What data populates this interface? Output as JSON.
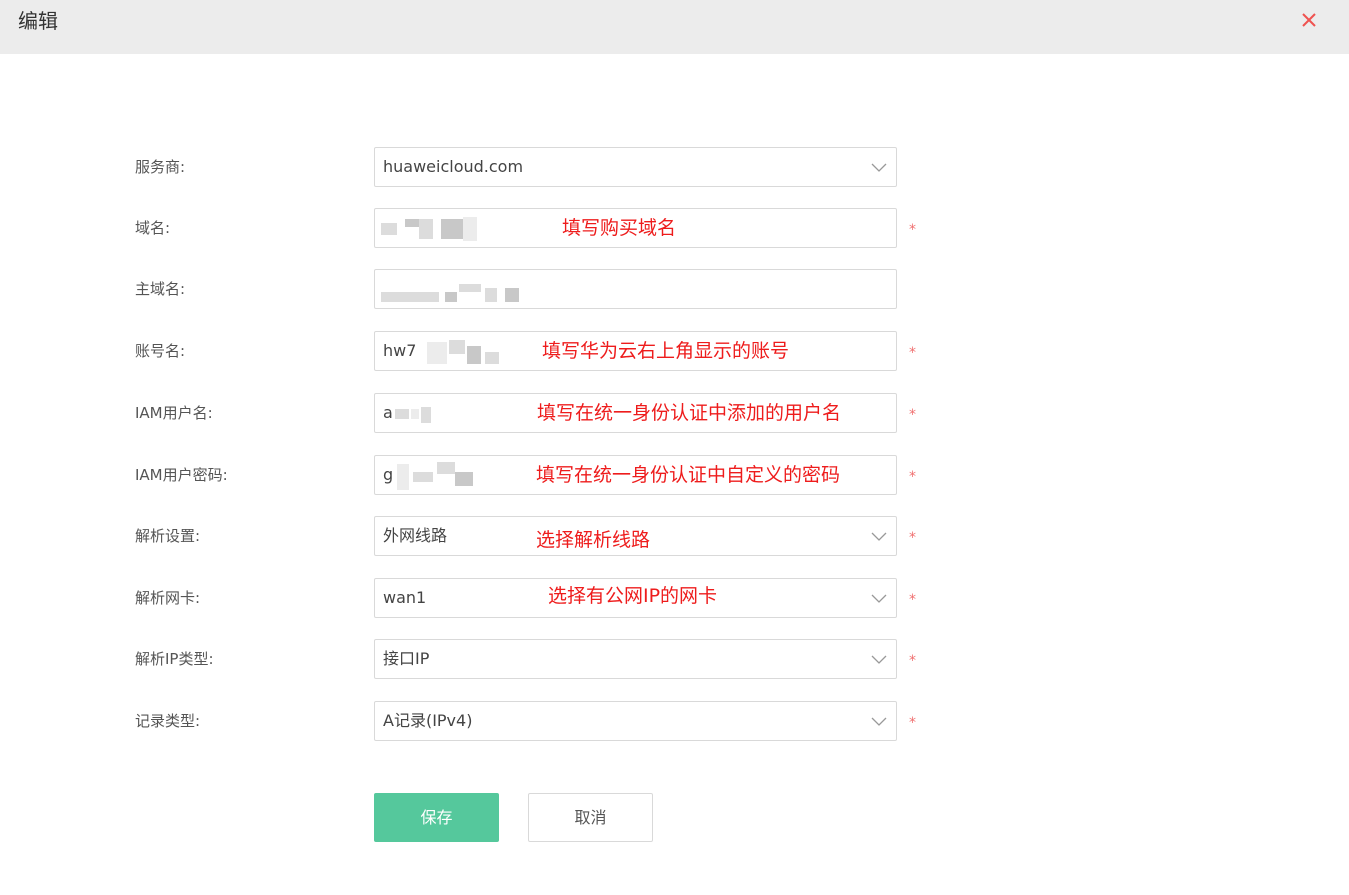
{
  "dialog": {
    "title": "编辑",
    "close_icon": "close-icon",
    "close_color": "#ef5350"
  },
  "form": {
    "provider": {
      "label": "服务商:",
      "value": "huaweicloud.com",
      "required": false
    },
    "domain": {
      "label": "域名:",
      "value": "",
      "annotation": "填写购买域名",
      "required": true,
      "required_mark": "*"
    },
    "main_domain": {
      "label": "主域名:",
      "value": "",
      "required": false
    },
    "account": {
      "label": "账号名:",
      "value": "hw7",
      "annotation": "填写华为云右上角显示的账号",
      "required": true,
      "required_mark": "*"
    },
    "iam_user": {
      "label": "IAM用户名:",
      "value": "a",
      "annotation": "填写在统一身份认证中添加的用户名",
      "required": true,
      "required_mark": "*"
    },
    "iam_password": {
      "label": "IAM用户密码:",
      "value": "g",
      "annotation": "填写在统一身份认证中自定义的密码",
      "required": true,
      "required_mark": "*"
    },
    "resolve_setting": {
      "label": "解析设置:",
      "value": "外网线路",
      "annotation": "选择解析线路",
      "required": true,
      "required_mark": "*"
    },
    "resolve_nic": {
      "label": "解析网卡:",
      "value": "wan1",
      "annotation": "选择有公网IP的网卡",
      "required": true,
      "required_mark": "*"
    },
    "resolve_ip_type": {
      "label": "解析IP类型:",
      "value": "接口IP",
      "required": true,
      "required_mark": "*"
    },
    "record_type": {
      "label": "记录类型:",
      "value": "A记录(IPv4)",
      "required": true,
      "required_mark": "*"
    }
  },
  "buttons": {
    "save_label": "保存",
    "cancel_label": "取消"
  },
  "colors": {
    "accent": "#55c89c",
    "annotation": "#ee1c1c",
    "required": "#f07070"
  }
}
